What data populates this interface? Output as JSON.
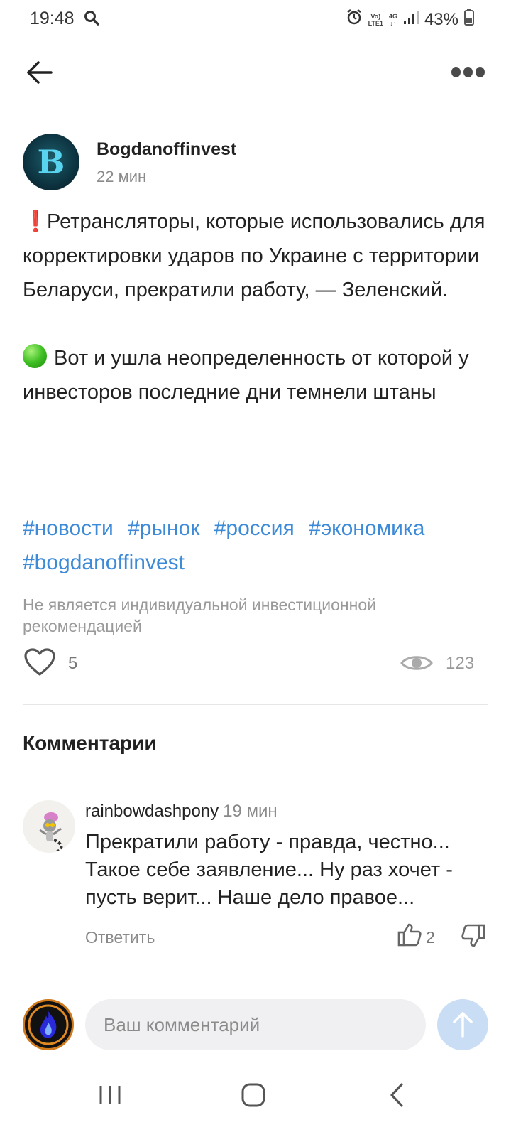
{
  "status_bar": {
    "time": "19:48",
    "net_top": "Vo)",
    "net_bottom": "LTE1",
    "gen_top": "4G",
    "battery": "43%"
  },
  "topbar": {
    "back_icon": "arrow-left-icon",
    "more_icon": "more-dots-icon"
  },
  "post": {
    "author": "Bogdanoffinvest",
    "avatar_letter": "B",
    "time": "22 мин",
    "paragraph1": "Ретрансляторы, которые использовались для корректировки ударов по Украине с территории Беларуси, прекратили работу, — Зеленский.",
    "paragraph2": "Вот и ушла неопределенность от которой у инвесторов последние дни темнели штаны",
    "tags": [
      "#новости",
      "#рынок",
      "#россия",
      "#экономика",
      "#bogdanoffinvest"
    ],
    "disclaimer": "Не является индивидуальной инвестиционной рекомендацией",
    "likes": "5",
    "views": "123"
  },
  "comments": {
    "title": "Комментарии",
    "items": [
      {
        "user": "rainbowdashpony",
        "time": "19 мин",
        "text": "Прекратили работу - правда, честно... Такое себе заявление... Ну раз хочет - пусть верит... Наше дело правое...",
        "reply_label": "Ответить",
        "upvotes": "2"
      }
    ]
  },
  "input": {
    "placeholder": "Ваш комментарий"
  },
  "colors": {
    "accent": "#3c8ad8",
    "send_button": "#c9ddf5",
    "muted": "#8a8a8a"
  }
}
